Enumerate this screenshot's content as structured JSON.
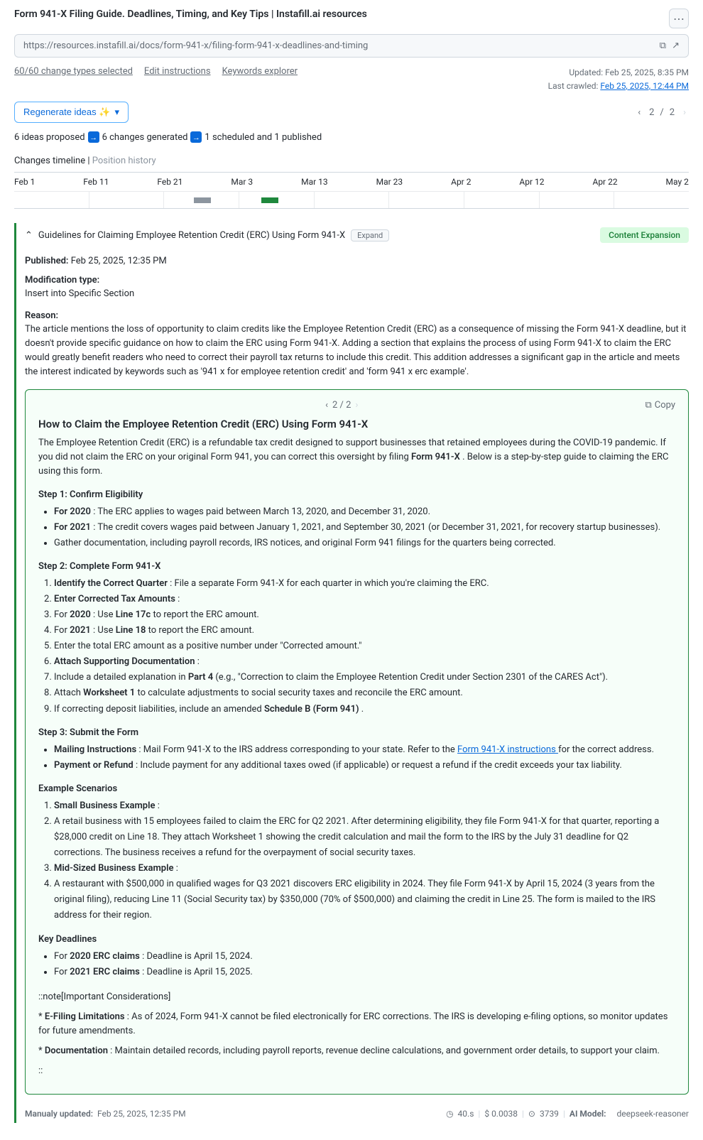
{
  "header": {
    "title": "Form 941-X Filing Guide. Deadlines, Timing, and Key Tips | Instafill.ai resources",
    "url": "https://resources.instafill.ai/docs/form-941-x/filing-form-941-x-deadlines-and-timing"
  },
  "links": {
    "change_types": "60/60 change types selected",
    "edit": "Edit instructions",
    "keywords": "Keywords explorer"
  },
  "meta": {
    "updated_label": "Updated:",
    "updated_value": "Feb 25, 2025, 8:35 PM",
    "crawled_label": "Last crawled:",
    "crawled_value": "Feb 25, 2025, 12:44 PM"
  },
  "regenerate": {
    "label": "Regenerate ideas ✨"
  },
  "pager": {
    "current": "2",
    "total": "2"
  },
  "status": {
    "ideas": "6 ideas proposed",
    "changes": "6 changes generated",
    "scheduled": "1 scheduled and 1 published"
  },
  "timeline": {
    "label": "Changes timeline",
    "position": "Position history",
    "dates": [
      "Feb 1",
      "Feb 11",
      "Feb 21",
      "Mar 3",
      "Mar 13",
      "Mar 23",
      "Apr 2",
      "Apr 12",
      "Apr 22",
      "May 2"
    ]
  },
  "card": {
    "title": "Guidelines for Claiming Employee Retention Credit (ERC) Using Form 941-X",
    "expand": "Expand",
    "badge": "Content Expansion",
    "published_label": "Published:",
    "published_value": "Feb 25, 2025, 12:35 PM",
    "mod_label": "Modification type:",
    "mod_value": "Insert into Specific Section",
    "reason_label": "Reason:",
    "reason_text": "The article mentions the loss of opportunity to claim credits like the Employee Retention Credit (ERC) as a consequence of missing the Form 941-X deadline, but it doesn't provide specific guidance on how to claim the ERC using Form 941-X. Adding a section that explains the process of using Form 941-X to claim the ERC would greatly benefit readers who need to correct their payroll tax returns to include this credit. This addition addresses a significant gap in the article and meets the interest indicated by keywords such as '941 x for employee retention credit' and 'form 941 x erc example'."
  },
  "content": {
    "pager": "2 / 2",
    "copy": "Copy",
    "h3": "How to Claim the Employee Retention Credit (ERC) Using Form 941-X",
    "intro_a": "The Employee Retention Credit (ERC) is a refundable tax credit designed to support businesses that retained employees during the COVID-19 pandemic. If you did not claim the ERC on your original Form 941, you can correct this oversight by filing ",
    "intro_bold": "Form 941-X",
    "intro_b": " . Below is a step-by-step guide to claiming the ERC using this form.",
    "step1_h": "Step 1: Confirm Eligibility",
    "step1": {
      "a_bold": "For 2020",
      "a_txt": " : The ERC applies to wages paid between March 13, 2020, and December 31, 2020.",
      "b_bold": "For 2021",
      "b_txt": " : The credit covers wages paid between January 1, 2021, and September 30, 2021 (or December 31, 2021, for recovery startup businesses).",
      "c": "Gather documentation, including payroll records, IRS notices, and original Form 941 filings for the quarters being corrected."
    },
    "step2_h": "Step 2: Complete Form 941-X",
    "step2": {
      "l1_bold": "Identify the Correct Quarter",
      "l1_txt": " : File a separate Form 941-X for each quarter in which you're claiming the ERC.",
      "l2_bold": "Enter Corrected Tax Amounts",
      "l2_txt": " :",
      "l3_a": "For ",
      "l3_bold1": "2020",
      "l3_b": " : Use ",
      "l3_bold2": "Line 17c",
      "l3_c": " to report the ERC amount.",
      "l4_a": "For ",
      "l4_bold1": "2021",
      "l4_b": " : Use ",
      "l4_bold2": "Line 18",
      "l4_c": " to report the ERC amount.",
      "l5": "Enter the total ERC amount as a positive number under \"Corrected amount.\"",
      "l6_bold": "Attach Supporting Documentation",
      "l6_txt": " :",
      "l7_a": "Include a detailed explanation in ",
      "l7_bold": "Part 4",
      "l7_b": " (e.g., \"Correction to claim the Employee Retention Credit under Section 2301 of the CARES Act\").",
      "l8_a": "Attach ",
      "l8_bold": "Worksheet 1",
      "l8_b": " to calculate adjustments to social security taxes and reconcile the ERC amount.",
      "l9_a": "If correcting deposit liabilities, include an amended ",
      "l9_bold": "Schedule B (Form 941)",
      "l9_b": " ."
    },
    "step3_h": "Step 3: Submit the Form",
    "step3": {
      "a_bold": "Mailing Instructions",
      "a_txt1": " : Mail Form 941-X to the IRS address corresponding to your state. Refer to the ",
      "a_link": "Form 941-X instructions ",
      "a_txt2": "for the correct address.",
      "b_bold": "Payment or Refund",
      "b_txt": " : Include payment for any additional taxes owed (if applicable) or request a refund if the credit exceeds your tax liability."
    },
    "examples_h": "Example Scenarios",
    "examples": {
      "l1_bold": "Small Business Example",
      "l1_txt": " :",
      "l2": "A retail business with 15 employees failed to claim the ERC for Q2 2021. After determining eligibility, they file Form 941-X for that quarter, reporting a $28,000 credit on Line 18. They attach Worksheet 1 showing the credit calculation and mail the form to the IRS by the July 31 deadline for Q2 corrections. The business receives a refund for the overpayment of social security taxes.",
      "l3_bold": "Mid-Sized Business Example",
      "l3_txt": " :",
      "l4": "A restaurant with $500,000 in qualified wages for Q3 2021 discovers ERC eligibility in 2024. They file Form 941-X by April 15, 2024 (3 years from the original filing), reducing Line 11 (Social Security tax) by $350,000 (70% of $500,000) and claiming the credit in Line 25. The form is mailed to the IRS address for their region."
    },
    "deadlines_h": "Key Deadlines",
    "deadlines": {
      "a_a": "For ",
      "a_bold": "2020 ERC claims",
      "a_b": " : Deadline is April 15, 2024.",
      "b_a": "For ",
      "b_bold": "2021 ERC claims",
      "b_b": " : Deadline is April 15, 2025."
    },
    "note_open": "::note[Important Considerations]",
    "note1_pre": "* ",
    "note1_bold": "E-Filing Limitations",
    "note1_txt": " : As of 2024, Form 941-X cannot be filed electronically for ERC corrections. The IRS is developing e-filing options, so monitor updates for future amendments.",
    "note2_pre": "* ",
    "note2_bold": "Documentation",
    "note2_txt": " : Maintain detailed records, including payroll reports, revenue decline calculations, and government order details, to support your claim.",
    "note_close": "::"
  },
  "footer": {
    "manual_label": "Manualy updated:",
    "manual_value": "Feb 25, 2025, 12:35 PM",
    "time": "40.s",
    "cost": "$ 0.0038",
    "tokens": "3739",
    "model_label": "AI Model:",
    "model_value": "deepseek-reasoner"
  }
}
